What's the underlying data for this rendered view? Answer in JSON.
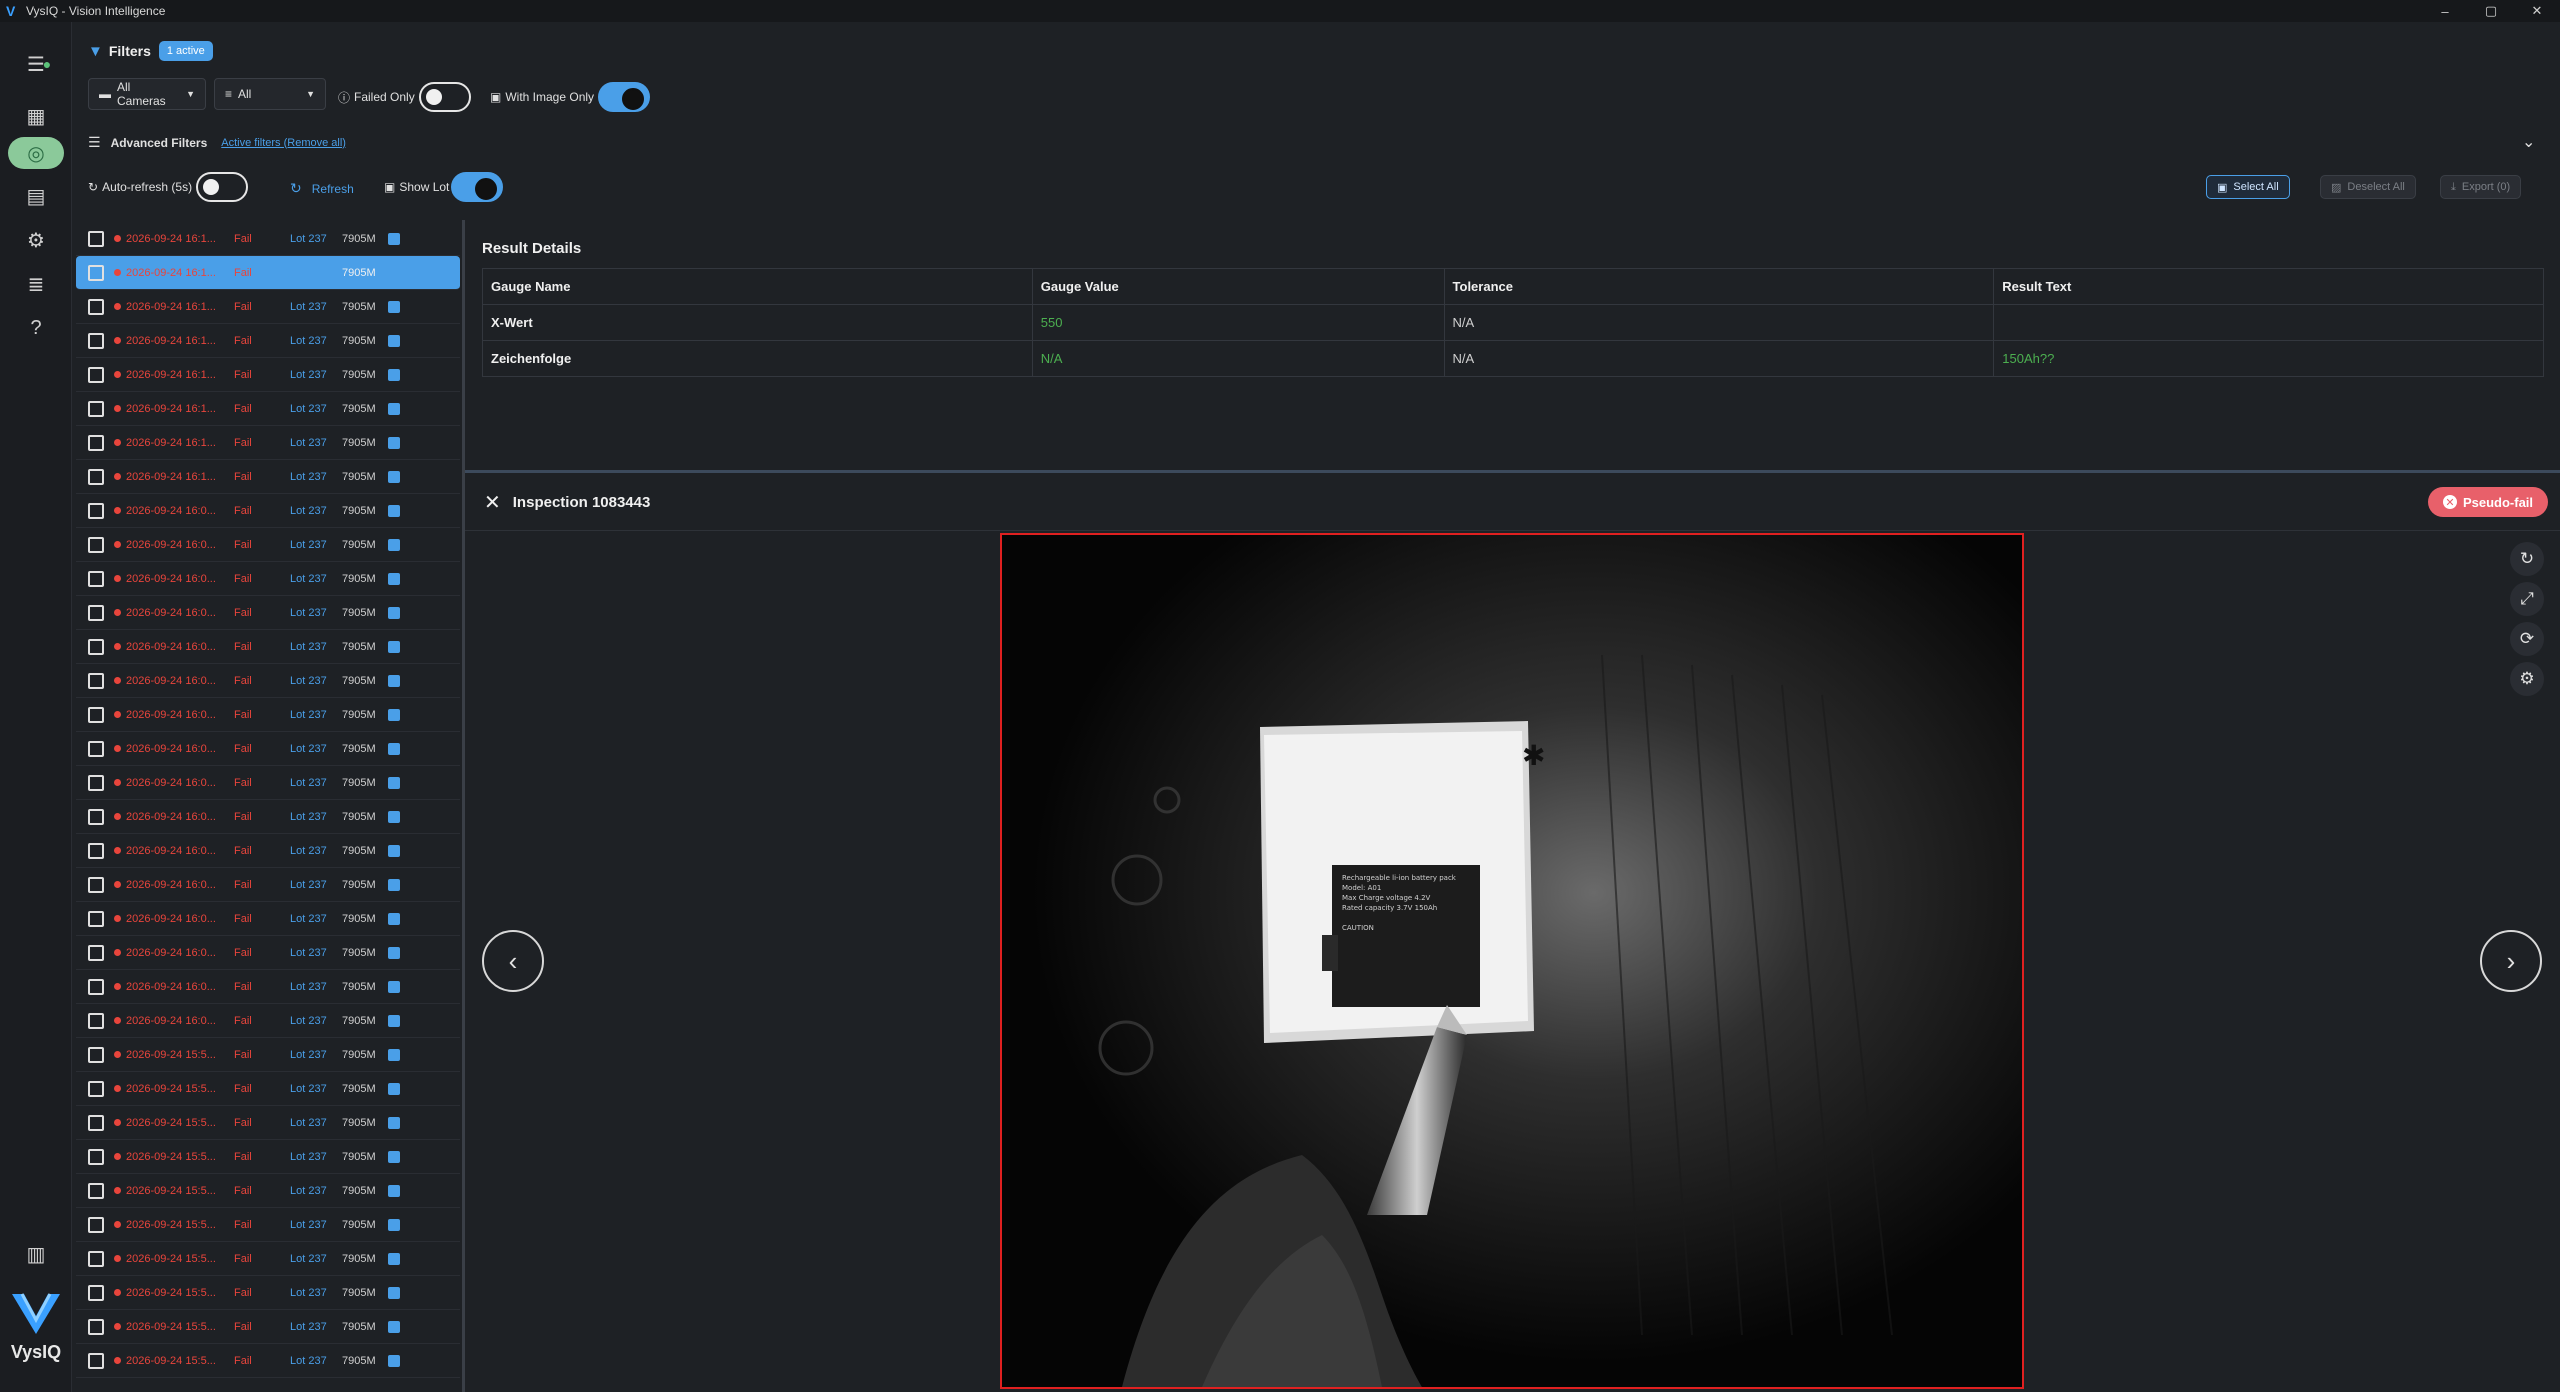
{
  "window": {
    "title": "VysIQ - Vision Intelligence",
    "min": "–",
    "max": "▢",
    "close": "✕"
  },
  "brand": {
    "name": "VysIQ"
  },
  "filters": {
    "label": "Filters",
    "active_badge": "1 active",
    "camera_select": "All Cameras",
    "status_select": "All",
    "failed_only": "Failed Only",
    "with_image_only": "With Image Only",
    "advanced": "Advanced Filters",
    "active_filters_link": "Active filters (Remove all)",
    "auto_refresh": "Auto-refresh (5s)",
    "refresh": "Refresh",
    "show_lot": "Show Lot"
  },
  "actions": {
    "select_all": "Select All",
    "deselect_all": "Deselect All",
    "export": "Export (0)"
  },
  "list": {
    "rows": [
      {
        "ts": "2026-09-24 16:1...",
        "status": "Fail",
        "lot": "Lot 237",
        "size": "7905M"
      },
      {
        "ts": "2026-09-24 16:1...",
        "status": "Fail",
        "lot": "",
        "size": "7905M",
        "selected": true
      },
      {
        "ts": "2026-09-24 16:1...",
        "status": "Fail",
        "lot": "Lot 237",
        "size": "7905M"
      },
      {
        "ts": "2026-09-24 16:1...",
        "status": "Fail",
        "lot": "Lot 237",
        "size": "7905M"
      },
      {
        "ts": "2026-09-24 16:1...",
        "status": "Fail",
        "lot": "Lot 237",
        "size": "7905M"
      },
      {
        "ts": "2026-09-24 16:1...",
        "status": "Fail",
        "lot": "Lot 237",
        "size": "7905M"
      },
      {
        "ts": "2026-09-24 16:1...",
        "status": "Fail",
        "lot": "Lot 237",
        "size": "7905M"
      },
      {
        "ts": "2026-09-24 16:1...",
        "status": "Fail",
        "lot": "Lot 237",
        "size": "7905M"
      },
      {
        "ts": "2026-09-24 16:0...",
        "status": "Fail",
        "lot": "Lot 237",
        "size": "7905M"
      },
      {
        "ts": "2026-09-24 16:0...",
        "status": "Fail",
        "lot": "Lot 237",
        "size": "7905M"
      },
      {
        "ts": "2026-09-24 16:0...",
        "status": "Fail",
        "lot": "Lot 237",
        "size": "7905M"
      },
      {
        "ts": "2026-09-24 16:0...",
        "status": "Fail",
        "lot": "Lot 237",
        "size": "7905M"
      },
      {
        "ts": "2026-09-24 16:0...",
        "status": "Fail",
        "lot": "Lot 237",
        "size": "7905M"
      },
      {
        "ts": "2026-09-24 16:0...",
        "status": "Fail",
        "lot": "Lot 237",
        "size": "7905M"
      },
      {
        "ts": "2026-09-24 16:0...",
        "status": "Fail",
        "lot": "Lot 237",
        "size": "7905M"
      },
      {
        "ts": "2026-09-24 16:0...",
        "status": "Fail",
        "lot": "Lot 237",
        "size": "7905M"
      },
      {
        "ts": "2026-09-24 16:0...",
        "status": "Fail",
        "lot": "Lot 237",
        "size": "7905M"
      },
      {
        "ts": "2026-09-24 16:0...",
        "status": "Fail",
        "lot": "Lot 237",
        "size": "7905M"
      },
      {
        "ts": "2026-09-24 16:0...",
        "status": "Fail",
        "lot": "Lot 237",
        "size": "7905M"
      },
      {
        "ts": "2026-09-24 16:0...",
        "status": "Fail",
        "lot": "Lot 237",
        "size": "7905M"
      },
      {
        "ts": "2026-09-24 16:0...",
        "status": "Fail",
        "lot": "Lot 237",
        "size": "7905M"
      },
      {
        "ts": "2026-09-24 16:0...",
        "status": "Fail",
        "lot": "Lot 237",
        "size": "7905M"
      },
      {
        "ts": "2026-09-24 16:0...",
        "status": "Fail",
        "lot": "Lot 237",
        "size": "7905M"
      },
      {
        "ts": "2026-09-24 16:0...",
        "status": "Fail",
        "lot": "Lot 237",
        "size": "7905M"
      },
      {
        "ts": "2026-09-24 15:5...",
        "status": "Fail",
        "lot": "Lot 237",
        "size": "7905M"
      },
      {
        "ts": "2026-09-24 15:5...",
        "status": "Fail",
        "lot": "Lot 237",
        "size": "7905M"
      },
      {
        "ts": "2026-09-24 15:5...",
        "status": "Fail",
        "lot": "Lot 237",
        "size": "7905M"
      },
      {
        "ts": "2026-09-24 15:5...",
        "status": "Fail",
        "lot": "Lot 237",
        "size": "7905M"
      },
      {
        "ts": "2026-09-24 15:5...",
        "status": "Fail",
        "lot": "Lot 237",
        "size": "7905M"
      },
      {
        "ts": "2026-09-24 15:5...",
        "status": "Fail",
        "lot": "Lot 237",
        "size": "7905M"
      },
      {
        "ts": "2026-09-24 15:5...",
        "status": "Fail",
        "lot": "Lot 237",
        "size": "7905M"
      },
      {
        "ts": "2026-09-24 15:5...",
        "status": "Fail",
        "lot": "Lot 237",
        "size": "7905M"
      },
      {
        "ts": "2026-09-24 15:5...",
        "status": "Fail",
        "lot": "Lot 237",
        "size": "7905M"
      },
      {
        "ts": "2026-09-24 15:5...",
        "status": "Fail",
        "lot": "Lot 237",
        "size": "7905M"
      }
    ]
  },
  "result_details": {
    "title": "Result Details",
    "headers": [
      "Gauge Name",
      "Gauge Value",
      "Tolerance",
      "Result Text"
    ],
    "rows": [
      {
        "name": "X-Wert",
        "value": "550",
        "tolerance": "N/A",
        "text": ""
      },
      {
        "name": "Zeichenfolge",
        "value": "N/A",
        "tolerance": "N/A",
        "text": "150Ah??"
      }
    ]
  },
  "inspection": {
    "title": "Inspection 1083443",
    "badge": "Pseudo-fail"
  },
  "colors": {
    "accent": "#4a9fe8",
    "fail": "#e8453c",
    "ok": "#4caf50",
    "pseudo": "#e8606a"
  },
  "icons": [
    "menu-icon",
    "user-icon",
    "dashboard-icon",
    "inspection-icon",
    "report-icon",
    "settings-icon",
    "list-icon",
    "help-icon",
    "database-icon",
    "filter-icon",
    "refresh-icon",
    "reset-icon",
    "fullscreen-icon",
    "rotate-icon",
    "gear-icon",
    "chevron-left-icon",
    "chevron-right-icon",
    "close-icon"
  ]
}
